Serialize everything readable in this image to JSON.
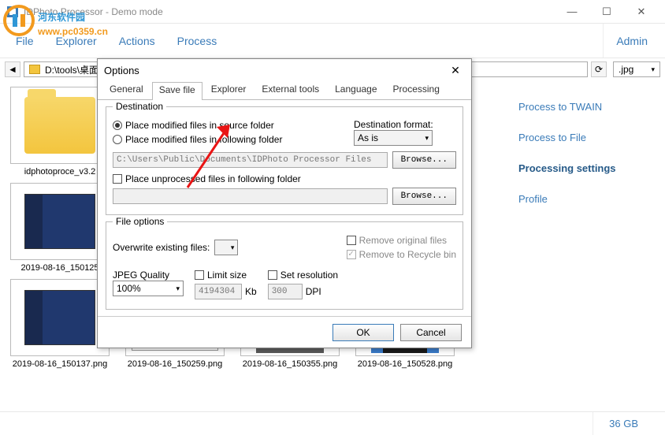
{
  "window": {
    "title": "IDPhoto Processor - Demo mode"
  },
  "menu": {
    "file": "File",
    "explorer": "Explorer",
    "actions": "Actions",
    "process": "Process",
    "admin": "Admin"
  },
  "address": {
    "path": "D:\\tools\\桌面\\",
    "ext": ".jpg"
  },
  "thumbs": {
    "t1": "idphotoproce_v3.2",
    "t2": "2019-08-16_150125",
    "t3": "2019-08-16_150137.png",
    "t4": "2019-08-16_150259.png",
    "t5": "2019-08-16_150355.png",
    "t6": "2019-08-16_150528.png"
  },
  "side": {
    "twain": "Process to TWAIN",
    "file": "Process to File",
    "settings": "Processing settings",
    "profile": "Profile"
  },
  "status": {
    "space": "36 GB"
  },
  "dialog": {
    "title": "Options",
    "tabs": {
      "general": "General",
      "savefile": "Save file",
      "explorer": "Explorer",
      "external": "External tools",
      "language": "Language",
      "processing": "Processing"
    },
    "dest": {
      "legend": "Destination",
      "opt1": "Place modified files in source folder",
      "opt2": "Place modified files in following folder",
      "format_label": "Destination format:",
      "format_value": "As is",
      "path": "C:\\Users\\Public\\Documents\\IDPhoto Processor Files",
      "browse": "Browse...",
      "unproc": "Place unprocessed files in following folder"
    },
    "fileopt": {
      "legend": "File options",
      "overwrite": "Overwrite existing files:",
      "remove_orig": "Remove original files",
      "remove_bin": "Remove to Recycle bin",
      "jpeg": "JPEG Quality",
      "jpeg_val": "100%",
      "limit": "Limit size",
      "limit_val": "4194304",
      "kb": "Kb",
      "setres": "Set resolution",
      "dpi_val": "300",
      "dpi": "DPI"
    },
    "ok": "OK",
    "cancel": "Cancel"
  },
  "watermark": {
    "text": "河东软件园",
    "url": "www.pc0359.cn"
  }
}
